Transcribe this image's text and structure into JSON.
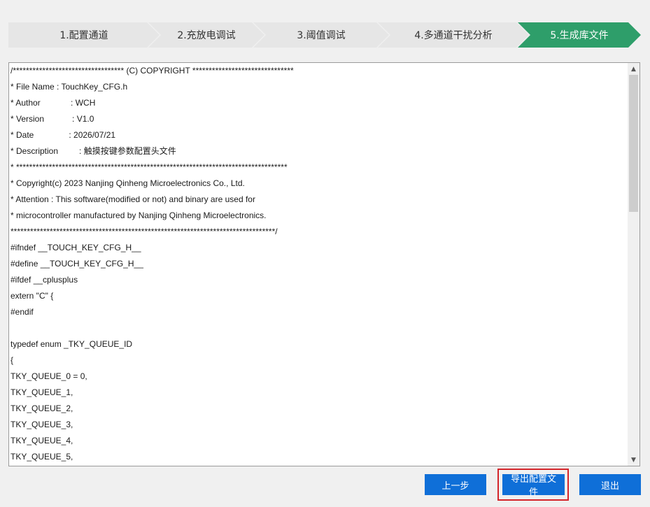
{
  "steps": [
    {
      "label": "1.配置通道",
      "active": false
    },
    {
      "label": "2.充放电调试",
      "active": false
    },
    {
      "label": "3.阈值调试",
      "active": false
    },
    {
      "label": "4.多通道干扰分析",
      "active": false
    },
    {
      "label": "5.生成库文件",
      "active": true
    }
  ],
  "code_lines": [
    "/********************************** (C) COPYRIGHT *******************************",
    "* File Name : TouchKey_CFG.h",
    "* Author             : WCH",
    "* Version            : V1.0",
    "* Date               : 2026/07/21",
    "* Description         : 触摸按键参数配置头文件",
    "* ***********************************************************************************",
    "* Copyright(c) 2023 Nanjing Qinheng Microelectronics Co., Ltd.",
    "* Attention : This software(modified or not) and binary are used for",
    "* microcontroller manufactured by Nanjing Qinheng Microelectronics.",
    "*********************************************************************************/",
    "#ifndef __TOUCH_KEY_CFG_H__",
    "#define __TOUCH_KEY_CFG_H__",
    "#ifdef __cplusplus",
    "extern \"C\" {",
    "#endif",
    "",
    "typedef enum _TKY_QUEUE_ID",
    "{",
    "TKY_QUEUE_0 = 0,",
    "TKY_QUEUE_1,",
    "TKY_QUEUE_2,",
    "TKY_QUEUE_3,",
    "TKY_QUEUE_4,",
    "TKY_QUEUE_5,"
  ],
  "scrollbar": {
    "up_icon": "▲",
    "down_icon": "▼"
  },
  "buttons": {
    "prev": "上一步",
    "export": "导出配置文件",
    "exit": "退出"
  },
  "colors": {
    "active_step": "#2e9e6a",
    "button": "#0f6fd8",
    "highlight": "#d4242a"
  }
}
